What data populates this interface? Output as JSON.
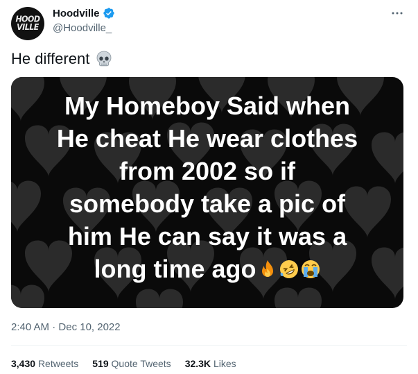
{
  "author": {
    "display_name": "Hoodville",
    "handle": "@Hoodville_",
    "avatar_text_top": "HOOD",
    "avatar_text_bottom": "VILLE",
    "verified_color": "#1d9bf0"
  },
  "tweet": {
    "text": "He different",
    "text_emoji": "skull-icon"
  },
  "media": {
    "caption_lines": [
      "My Homeboy Said when",
      "He cheat He wear clothes",
      "from 2002 so if",
      "somebody take a pic of",
      "him He can say it was a",
      "long time ago"
    ],
    "caption_emojis": [
      "fire-icon",
      "rofl-icon",
      "crying-icon"
    ],
    "background": "#0a0a0a"
  },
  "meta": {
    "time": "2:40 AM",
    "separator": " · ",
    "date": "Dec 10, 2022"
  },
  "stats": {
    "retweets_count": "3,430",
    "retweets_label": "Retweets",
    "quotes_count": "519",
    "quotes_label": "Quote Tweets",
    "likes_count": "32.3K",
    "likes_label": "Likes"
  }
}
